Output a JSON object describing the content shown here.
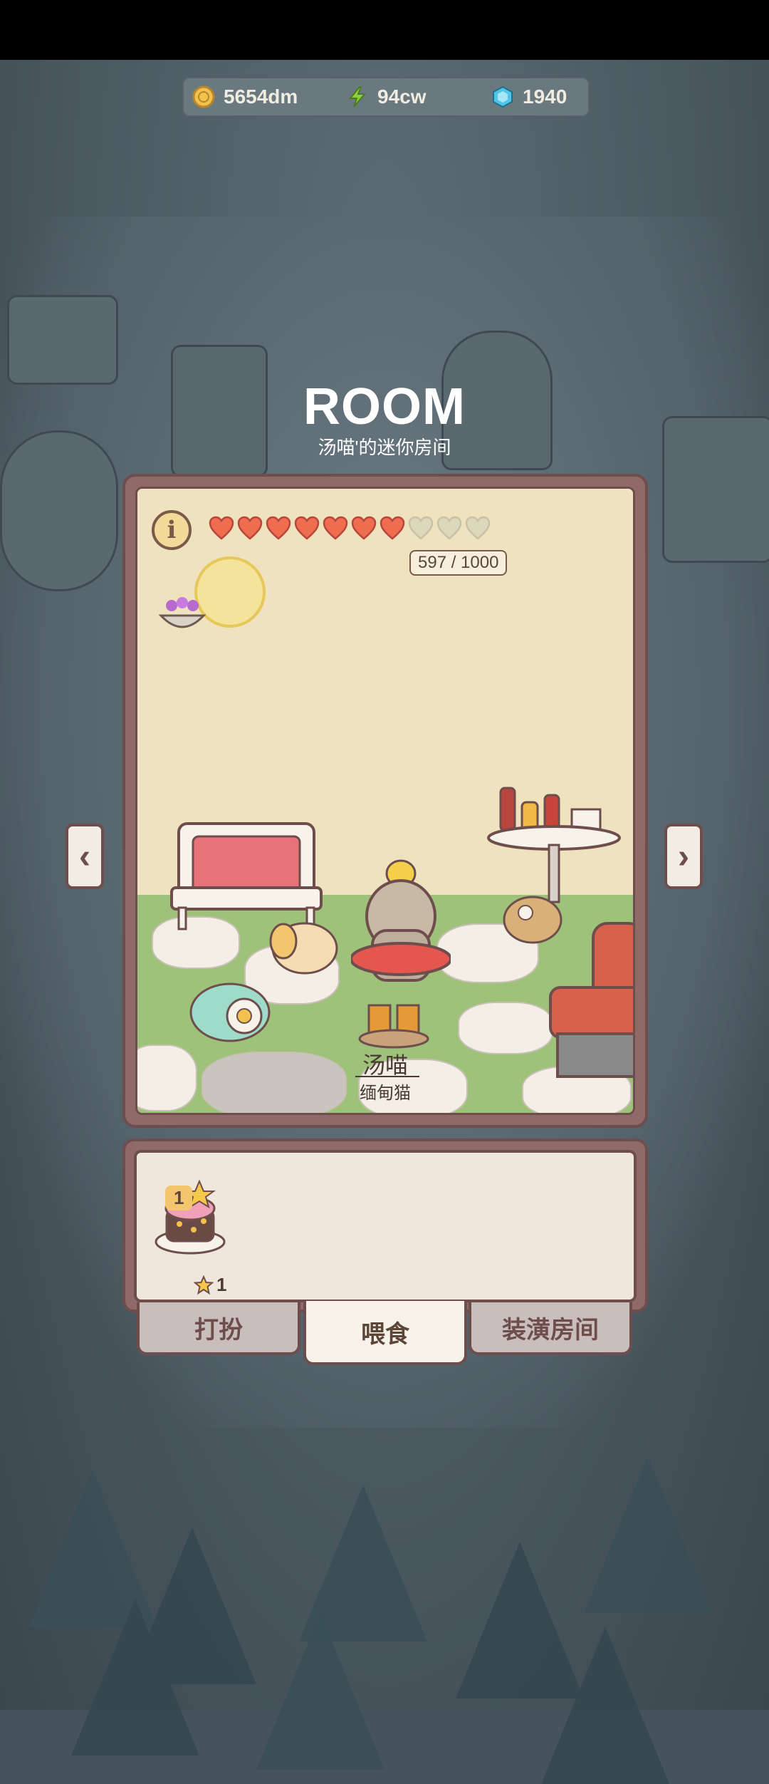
{
  "currency": {
    "coins": "5654dm",
    "energy": "94cw",
    "gems": "1940",
    "coin_icon": "coin-icon",
    "energy_icon": "lightning-icon",
    "gem_icon": "gem-icon"
  },
  "header": {
    "title": "ROOM",
    "subtitle": "汤喵'的迷你房间"
  },
  "room": {
    "hearts_filled": 7,
    "hearts_total": 10,
    "mood": "597 / 1000",
    "info_label": "i",
    "cat_name": "汤喵",
    "cat_breed": "缅甸猫",
    "prev_label": "‹",
    "next_label": "›"
  },
  "inventory": {
    "items": [
      {
        "name": "cake-item",
        "count": "1",
        "stars": "1"
      }
    ]
  },
  "tabs": [
    {
      "label": "打扮",
      "active": false
    },
    {
      "label": "喂食",
      "active": true
    },
    {
      "label": "装潢房间",
      "active": false
    }
  ],
  "colors": {
    "frame": "#8f6a68",
    "heart_filled": "#ef6e4f",
    "heart_empty": "#ddd7bc",
    "background": "#46535c"
  }
}
